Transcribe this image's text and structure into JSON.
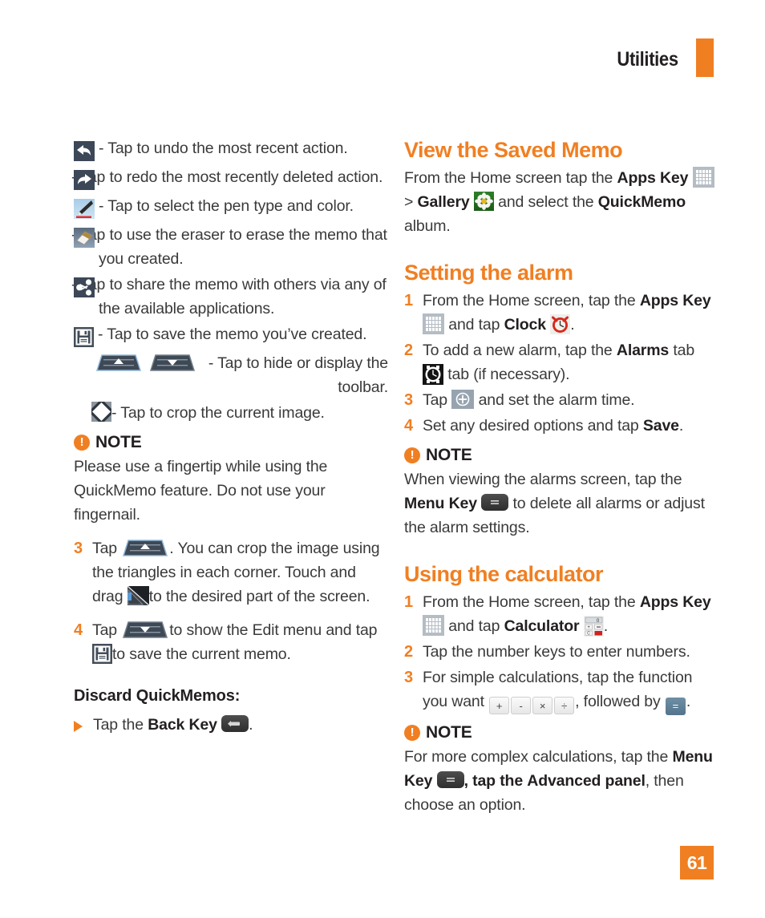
{
  "header": {
    "title": "Utilities",
    "accent_color": "#f07f22"
  },
  "page_number": "61",
  "left_column": {
    "icon_list": [
      {
        "icon": "undo-icon",
        "text": "- Tap to undo the most recent action."
      },
      {
        "icon": "redo-icon",
        "text": "- Tap to redo the most recently deleted action."
      },
      {
        "icon": "pen-icon",
        "text": "- Tap to select the pen type and color."
      },
      {
        "icon": "eraser-icon",
        "text": "- Tap to use the eraser to erase the memo that you created."
      },
      {
        "icon": "share-icon",
        "text": "- Tap to share the memo with others via any of the available applications."
      },
      {
        "icon": "save-icon",
        "text": "- Tap to save the memo you’ve created."
      }
    ],
    "toolbar_line": {
      "icon_up": "toolbar-up-icon",
      "icon_down": "toolbar-down-icon",
      "text": "- Tap to hide or display the toolbar."
    },
    "crop_line": {
      "icon": "crop-icon",
      "text": "- Tap to crop the current image."
    },
    "note": {
      "label": "NOTE",
      "body": "Please use a fingertip while using the QuickMemo feature. Do not use your fingernail."
    },
    "steps": [
      {
        "num": "3",
        "part1": "Tap",
        "icon1": "toolbar-up-icon",
        "part2": ". You can crop the image using the triangles in each corner. Touch and drag",
        "icon2": "corner-handle-icon",
        "part3": "to the desired part of the screen."
      },
      {
        "num": "4",
        "part1": "Tap",
        "icon1": "toolbar-down-icon",
        "part2": "to show the Edit menu and tap",
        "icon2": "save-icon",
        "part3": "to save the current memo."
      }
    ],
    "discard": {
      "heading_bold": "Discard QuickMemos",
      "heading_tail": ":",
      "item_part1": "Tap the",
      "item_bold": "Back Key",
      "item_icon": "back-key-icon",
      "item_tail": "."
    }
  },
  "right_column": {
    "view_saved_memo": {
      "title": "View the Saved Memo",
      "p1": "From the Home screen tap the",
      "apps_key_bold": "Apps Key",
      "apps_key_icon": "apps-key-icon",
      "p2": ">",
      "gallery_bold": "Gallery",
      "gallery_icon": "gallery-icon",
      "p3": "and select the",
      "quickmemo_bold": "QuickMemo",
      "p4": "album."
    },
    "setting_the_alarm": {
      "title": "Setting the alarm",
      "steps": [
        {
          "num": "1",
          "part1": "From the Home screen, tap the",
          "bold1": "Apps Key",
          "icon1": "apps-key-icon",
          "part2": "and tap",
          "bold2": "Clock",
          "icon2": "clock-icon",
          "part3": "."
        },
        {
          "num": "2",
          "part1": "To add a new alarm, tap the",
          "bold1": "Alarms",
          "part2": "tab",
          "icon1": "alarms-tab-icon",
          "part3": "tab (if necessary)."
        },
        {
          "num": "3",
          "part1": "Tap",
          "icon1": "plus-icon",
          "part2": "and set the alarm time."
        },
        {
          "num": "4",
          "part1": "Set any desired options and tap",
          "bold1": "Save",
          "part2": "."
        }
      ],
      "note": {
        "label": "NOTE",
        "body_part1": "When viewing the alarms screen, tap the",
        "body_bold": "Menu Key",
        "body_icon": "menu-key-icon",
        "body_part2": "to delete all alarms or adjust the alarm settings."
      }
    },
    "using_the_calculator": {
      "title": "Using the calculator",
      "steps": [
        {
          "num": "1",
          "part1": "From the Home screen, tap the",
          "bold1": "Apps Key",
          "icon1": "apps-key-icon",
          "part2": "and tap",
          "bold2": "Calculator",
          "icon2": "calculator-icon",
          "part3": "."
        },
        {
          "num": "2",
          "part1": "Tap the number keys to enter numbers."
        },
        {
          "num": "3",
          "part1": "For simple calculations, tap the function you want",
          "keys": [
            "+",
            "-",
            "×",
            "÷"
          ],
          "part2": ", followed by",
          "equals_key": "=",
          "part3": "."
        }
      ],
      "note": {
        "label": "NOTE",
        "body_part1": "For more complex calculations, tap the",
        "body_bold1": "Menu Key",
        "body_icon": "menu-key-icon",
        "body_part2": ", tap the",
        "body_bold2": "Advanced panel",
        "body_part3": ", then choose an option."
      }
    }
  }
}
